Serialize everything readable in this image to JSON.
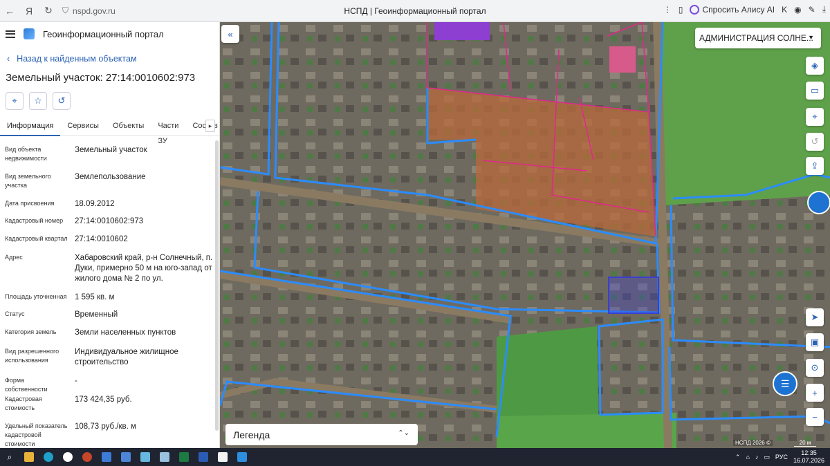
{
  "browser": {
    "url": "nspd.gov.ru",
    "title": "НСПД | Геоинформационный портал",
    "alice_label": "Спросить Алису AI"
  },
  "app": {
    "name": "Геоинформационный портал",
    "back_label": "Назад к найденным объектам",
    "object_title": "Земельный участок: 27:14:0010602:973",
    "tabs": [
      "Информация",
      "Сервисы",
      "Объекты",
      "Части ЗУ",
      "Состав"
    ],
    "active_tab": "Информация"
  },
  "properties": [
    {
      "key": "Вид объекта недвижимости",
      "value": "Земельный участок"
    },
    {
      "key": "Вид земельного участка",
      "value": "Землепользование"
    },
    {
      "key": "Дата присвоения",
      "value": "18.09.2012"
    },
    {
      "key": "Кадастровый номер",
      "value": "27:14:0010602:973"
    },
    {
      "key": "Кадастровый квартал",
      "value": "27:14:0010602"
    },
    {
      "key": "Адрес",
      "value": "Хабаровский край, р-н Солнечный, п. Дуки, примерно 50 м на юго-запад от жилого дома № 2 по ул."
    },
    {
      "key": "Площадь уточненная",
      "value": "1 595 кв. м"
    },
    {
      "key": "Статус",
      "value": "Временный"
    },
    {
      "key": "Категория земель",
      "value": "Земли населенных пунктов"
    },
    {
      "key": "Вид разрешенного использования",
      "value": "Индивидуальное жилищное строительство"
    },
    {
      "key": "Форма собственности",
      "value": "-"
    },
    {
      "key": "Кадастровая стоимость",
      "value": "173 424,35 руб."
    },
    {
      "key": "Удельный показатель кадастровой стоимости",
      "value": "108,73 руб./кв. м"
    }
  ],
  "map": {
    "admin_select": "АДМИНИСТРАЦИЯ СОЛНЕ...",
    "legend_label": "Легенда",
    "copyright": "НСПД 2026 ©",
    "scale": "20 м"
  },
  "taskbar": {
    "language": "РУС",
    "time": "12:35",
    "date": "16.07.2026"
  },
  "colors": {
    "accent": "#2c63b5",
    "quarter_border": "#2b8cff",
    "parcel_border": "#e0288c",
    "selected_parcel": "#3b3fd0"
  }
}
